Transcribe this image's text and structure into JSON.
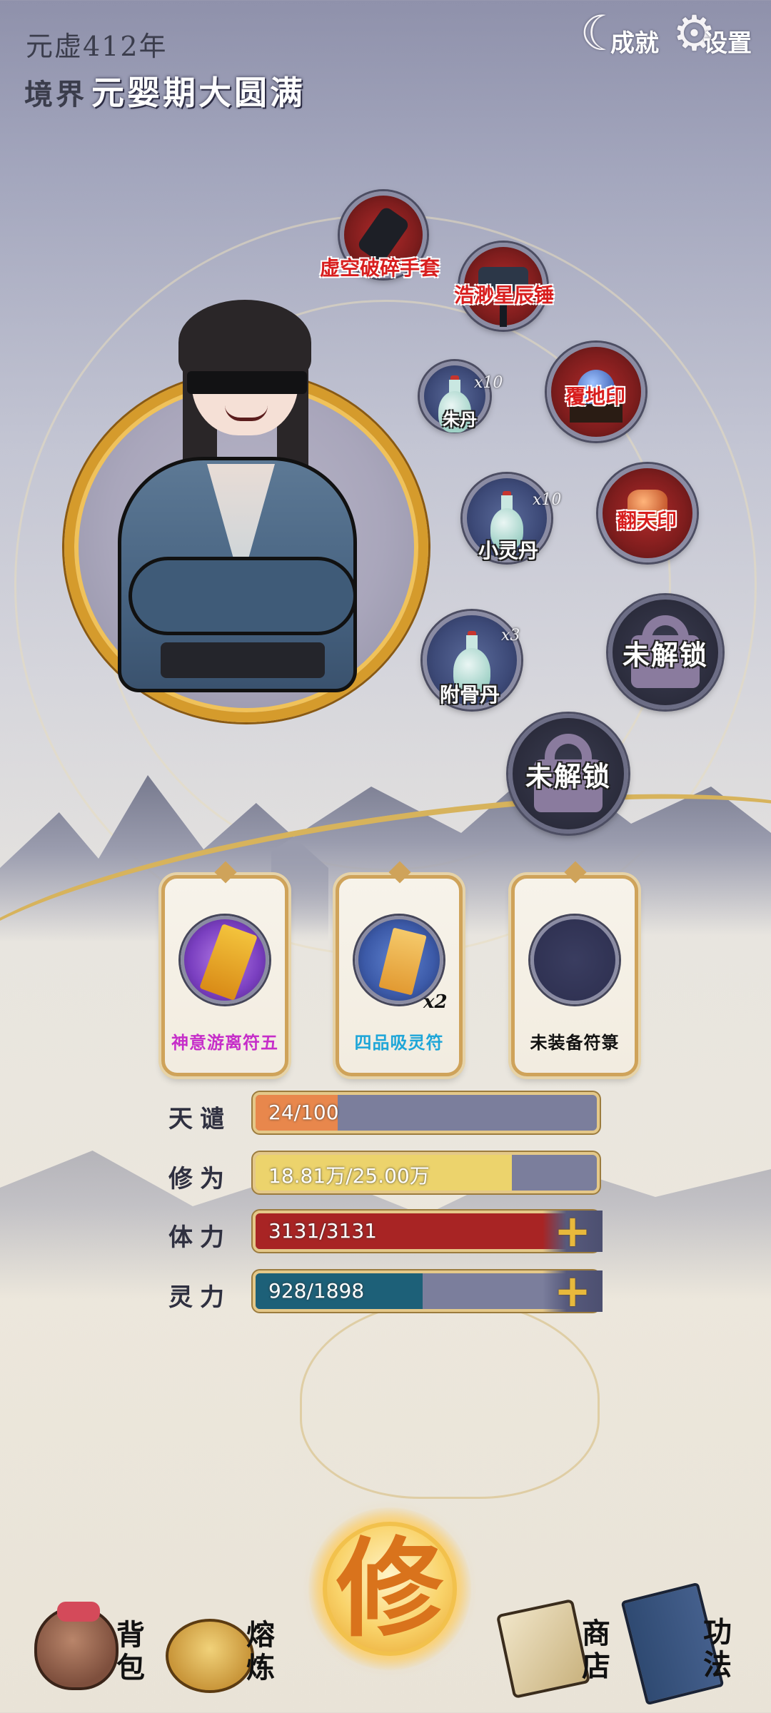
{
  "header": {
    "year": "元虚412年",
    "realm_label": "境界",
    "realm_value": "元婴期大圆满"
  },
  "top_buttons": [
    {
      "label": "成就",
      "icon": "crescent-star-icon"
    },
    {
      "label": "设置",
      "icon": "gear-icon"
    }
  ],
  "equipment": {
    "gloves": {
      "name": "虚空破碎手套"
    },
    "hammer": {
      "name": "浩渺星辰锤"
    },
    "pill_a": {
      "name": "朱丹",
      "count": "x10"
    },
    "seal_earth": {
      "name": "覆地印"
    },
    "pill_b": {
      "name": "小灵丹",
      "count": "x10"
    },
    "seal_heaven": {
      "name": "翻天印"
    },
    "pill_c": {
      "name": "附骨丹",
      "count": "x3"
    },
    "locked_1": {
      "name": "未解锁"
    },
    "locked_2": {
      "name": "未解锁"
    }
  },
  "talismans": [
    {
      "name": "神意游离符五",
      "color": "#c62ec9",
      "qty": ""
    },
    {
      "name": "四品吸灵符",
      "color": "#1fa6d8",
      "qty": "x2"
    },
    {
      "name": "未装备符箓",
      "color": "#111111",
      "qty": ""
    }
  ],
  "stats": [
    {
      "label": "天谴",
      "text": "24/100",
      "fill": 0.24,
      "color": "#e8874c",
      "plus": false
    },
    {
      "label": "修为",
      "text": "18.81万/25.00万",
      "fill": 0.752,
      "color": "#ecd36c",
      "plus": false
    },
    {
      "label": "体力",
      "text": "3131/3131",
      "fill": 1.0,
      "color": "#a82424",
      "plus": true
    },
    {
      "label": "灵力",
      "text": "928/1898",
      "fill": 0.489,
      "color": "#1d6078",
      "plus": true
    }
  ],
  "plus_glyph": "+",
  "nav": {
    "bag": "背包",
    "forge": "熔炼",
    "cultivate": "修",
    "shop": "商店",
    "skills": "功法"
  }
}
